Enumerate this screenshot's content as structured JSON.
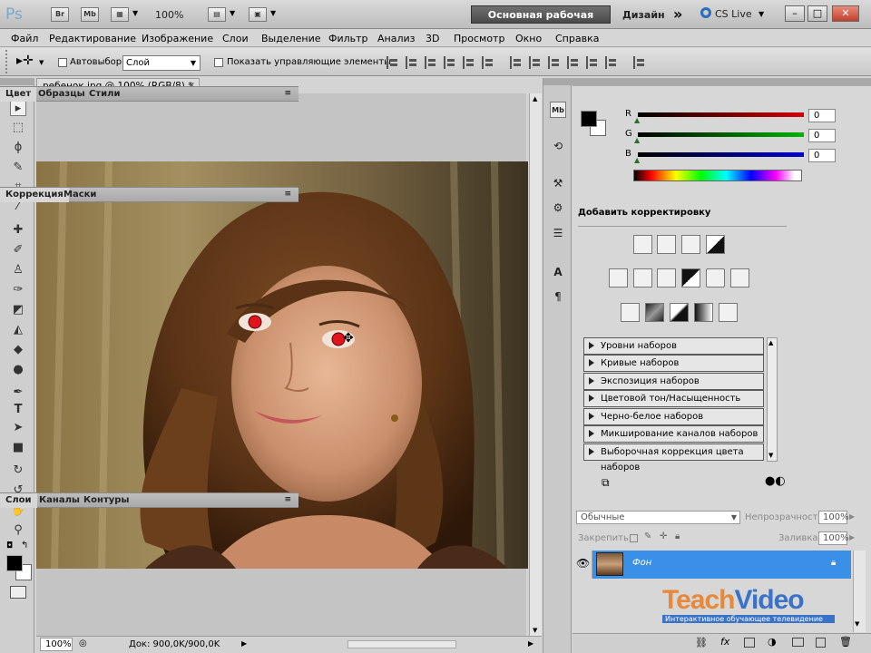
{
  "app": {
    "logo": "Ps",
    "bridge_label": "Br",
    "minibridge_label": "Mb",
    "zoom": "100%",
    "workspace_label": "Основная рабочая среда",
    "design_label": "Дизайн",
    "more_label": "»",
    "cslive_label": "CS Live",
    "minimize": "–",
    "restore": "□",
    "close": "✕"
  },
  "menu": [
    "Файл",
    "Редактирование",
    "Изображение",
    "Слои",
    "Выделение",
    "Фильтр",
    "Анализ",
    "3D",
    "Просмотр",
    "Окно",
    "Справка"
  ],
  "options": {
    "autoselect_label": "Автовыбор:",
    "autoselect_value": "Слой",
    "show_controls_label": "Показать управляющие элементы"
  },
  "document": {
    "tab_title": "ребенок.jpg @ 100% (RGB/8) *",
    "tab_close": "✕",
    "status_zoom": "100%",
    "status_doc": "Док: 900,0K/900,0K"
  },
  "color_panel": {
    "tabs": [
      "Цвет",
      "Образцы",
      "Стили"
    ],
    "channels": [
      {
        "label": "R",
        "value": "0",
        "color": "#d40000"
      },
      {
        "label": "G",
        "value": "0",
        "color": "#00b400"
      },
      {
        "label": "B",
        "value": "0",
        "color": "#0000d0"
      }
    ]
  },
  "adjust_panel": {
    "tabs": [
      "Коррекция",
      "Маски"
    ],
    "heading": "Добавить корректировку",
    "presets": [
      "Уровни наборов",
      "Кривые наборов",
      "Экспозиция наборов",
      "Цветовой тон/Насыщенность наборов",
      "Черно-белое наборов",
      "Микширование каналов наборов",
      "Выборочная коррекция цвета наборов"
    ]
  },
  "layers_panel": {
    "tabs": [
      "Слои",
      "Каналы",
      "Контуры"
    ],
    "blend_mode": "Обычные",
    "opacity_label": "Непрозрачность:",
    "opacity_value": "100%",
    "lock_label": "Закрепить:",
    "fill_label": "Заливка:",
    "fill_value": "100%",
    "layer_name": "Фон"
  },
  "watermark": {
    "brand_teach": "Teach",
    "brand_video": "Video",
    "tagline": "Интерактивное обучающее телевидение"
  }
}
